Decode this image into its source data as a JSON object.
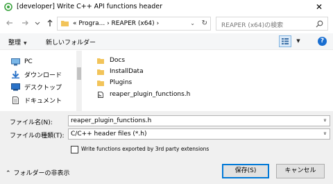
{
  "window": {
    "title": "[developer] Write C++ API functions header",
    "close_glyph": "✕"
  },
  "nav": {
    "breadcrumb_prefix": "«",
    "breadcrumb_1": "Progra...",
    "breadcrumb_sep": "›",
    "breadcrumb_2": "REAPER (x64)",
    "breadcrumb_arrow": "›",
    "dropdown_glyph": "⌄",
    "refresh_glyph": "↻",
    "search_placeholder": "REAPER (x64)の検索"
  },
  "toolbar": {
    "organize_label": "整理",
    "organize_caret": "▼",
    "new_folder_label": "新しいフォルダー",
    "view_dropdown_glyph": "▼",
    "help_glyph": "?"
  },
  "sidebar": {
    "items": [
      {
        "label": "PC",
        "icon": "pc-icon"
      },
      {
        "label": "ダウンロード",
        "icon": "download-icon"
      },
      {
        "label": "デスクトップ",
        "icon": "desktop-icon"
      },
      {
        "label": "ドキュメント",
        "icon": "document-icon"
      }
    ]
  },
  "files": [
    {
      "name": "Docs",
      "icon": "folder-icon"
    },
    {
      "name": "InstallData",
      "icon": "folder-icon"
    },
    {
      "name": "Plugins",
      "icon": "folder-icon"
    },
    {
      "name": "reaper_plugin_functions.h",
      "icon": "file-h-icon"
    }
  ],
  "form": {
    "filename_label": "ファイル名(N):",
    "filename_value": "reaper_plugin_functions.h",
    "filetype_label": "ファイルの種類(T):",
    "filetype_value": "C/C++ header files (*.h)",
    "dropdown_caret": "∨",
    "checkbox_label": "Write functions exported by 3rd party extensions",
    "checkbox_checked": false
  },
  "footer": {
    "hide_folders_caret": "⌃",
    "hide_folders_label": "フォルダーの非表示",
    "save_label": "保存(S)",
    "cancel_label": "キャンセル"
  },
  "colors": {
    "folder": "#f2c45a",
    "accent": "#0078d7",
    "app_icon": "#3aa33e"
  }
}
